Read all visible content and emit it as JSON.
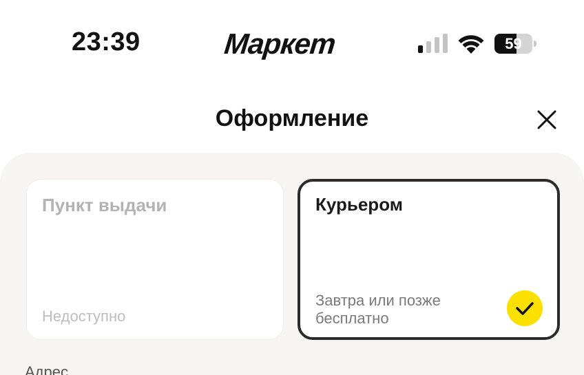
{
  "status_bar": {
    "time": "23:39",
    "brand": "Маркет",
    "battery_level": "59",
    "battery_fraction": 0.59
  },
  "header": {
    "title": "Оформление",
    "close_icon": "close-icon"
  },
  "delivery_options": [
    {
      "title": "Пункт выдачи",
      "subtitle_line1": "Недоступно",
      "subtitle_line2": "",
      "state": "disabled"
    },
    {
      "title": "Курьером",
      "subtitle_line1": "Завтра или позже",
      "subtitle_line2": "бесплатно",
      "state": "selected"
    }
  ],
  "address": {
    "label": "Адрес"
  },
  "colors": {
    "accent_yellow": "#fce000",
    "sheet_background": "#f6f5f3",
    "selected_border": "#2b2b2b",
    "text_primary": "#111111",
    "text_disabled": "#b3b3b3"
  }
}
